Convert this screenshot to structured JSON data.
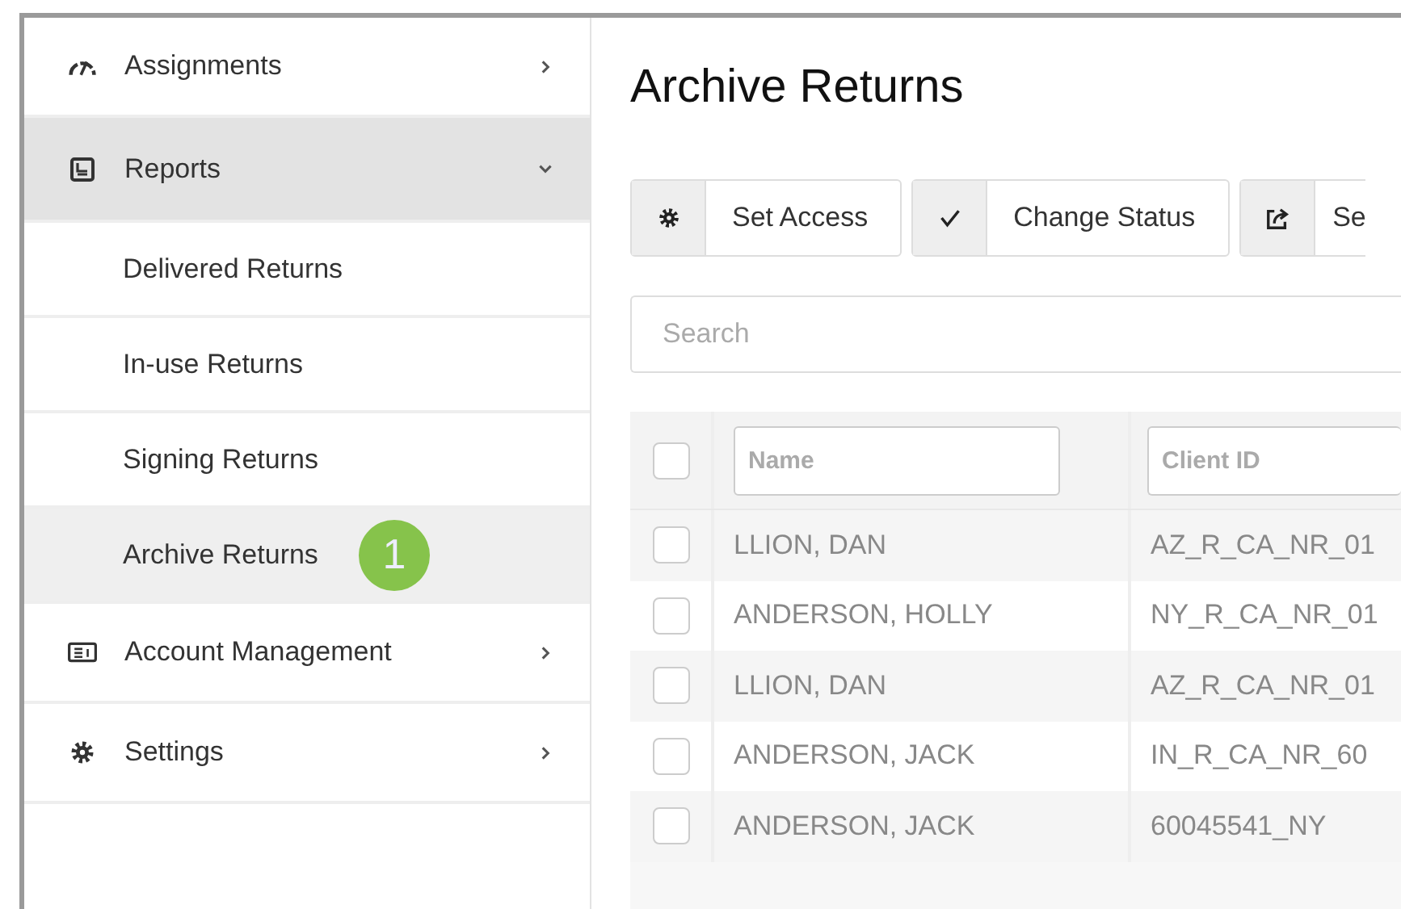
{
  "sidebar": {
    "items": [
      {
        "label": "Assignments",
        "selected": false,
        "expanded": false
      },
      {
        "label": "Reports",
        "selected": true,
        "expanded": true,
        "children": [
          {
            "label": "Delivered Returns",
            "selected": false
          },
          {
            "label": "In-use Returns",
            "selected": false
          },
          {
            "label": "Signing Returns",
            "selected": false
          },
          {
            "label": "Archive Returns",
            "selected": true,
            "badge": "1"
          }
        ]
      },
      {
        "label": "Account Management",
        "selected": false,
        "expanded": false
      },
      {
        "label": "Settings",
        "selected": false,
        "expanded": false
      }
    ]
  },
  "page_title": "Archive Returns",
  "toolbar": [
    {
      "label": "Set Access"
    },
    {
      "label": "Change Status"
    },
    {
      "label": "Se"
    }
  ],
  "search": {
    "placeholder": "Search"
  },
  "table": {
    "columns": [
      {
        "placeholder": "Name"
      },
      {
        "placeholder": "Client ID"
      }
    ],
    "select_all": {
      "checked": false
    },
    "rows": [
      {
        "checked": false,
        "cells": [
          "LLION, DAN",
          "AZ_R_CA_NR_01"
        ]
      },
      {
        "checked": false,
        "cells": [
          "ANDERSON, HOLLY",
          "NY_R_CA_NR_01"
        ]
      },
      {
        "checked": false,
        "cells": [
          "LLION, DAN",
          "AZ_R_CA_NR_01"
        ]
      },
      {
        "checked": false,
        "cells": [
          "ANDERSON, JACK",
          "IN_R_CA_NR_60"
        ]
      },
      {
        "checked": false,
        "cells": [
          "ANDERSON, JACK",
          "60045541_NY"
        ]
      }
    ]
  }
}
